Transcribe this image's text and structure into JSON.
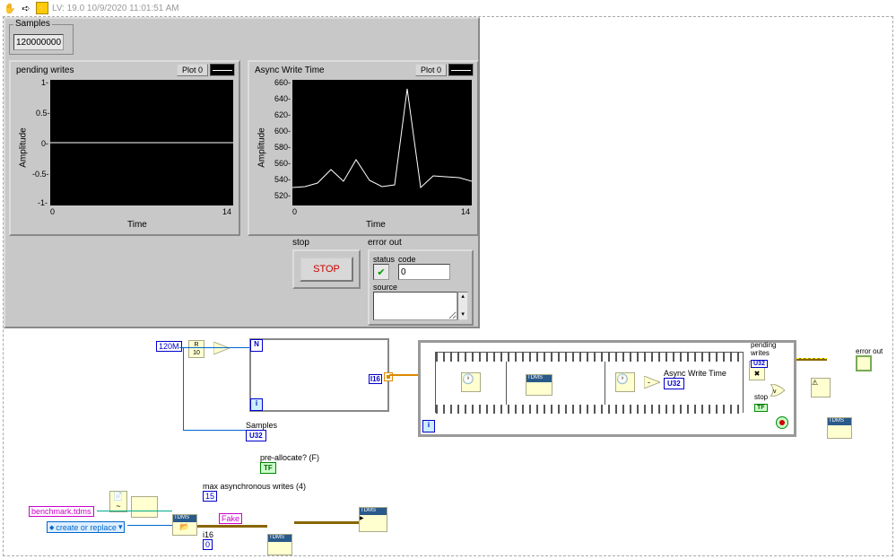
{
  "title": "LV: 19.0 10/9/2020 11:01:51 AM",
  "samples": {
    "label": "Samples",
    "value": "120000000"
  },
  "chart1": {
    "title": "pending writes",
    "legend": "Plot 0",
    "ylabel": "Amplitude",
    "xlabel": "Time",
    "xmin": "0",
    "xmax": "14"
  },
  "chart2": {
    "title": "Async Write Time",
    "legend": "Plot 0",
    "ylabel": "Amplitude",
    "xlabel": "Time",
    "xmin": "0",
    "xmax": "14"
  },
  "chart_data": [
    {
      "type": "line",
      "title": "pending writes",
      "xlabel": "Time",
      "ylabel": "Amplitude",
      "xlim": [
        0,
        14
      ],
      "ylim": [
        -1,
        1
      ],
      "x": [
        0,
        1,
        2,
        3,
        4,
        5,
        6,
        7,
        8,
        9,
        10,
        11,
        12,
        13,
        14
      ],
      "values": [
        0,
        0,
        0,
        0,
        0,
        0,
        0,
        0,
        0,
        0,
        0,
        0,
        0,
        0,
        0
      ]
    },
    {
      "type": "line",
      "title": "Async Write Time",
      "xlabel": "Time",
      "ylabel": "Amplitude",
      "xlim": [
        0,
        14
      ],
      "ylim": [
        520,
        660
      ],
      "x": [
        0,
        1,
        2,
        3,
        4,
        5,
        6,
        7,
        8,
        9,
        10,
        11,
        12,
        13,
        14
      ],
      "values": [
        540,
        541,
        545,
        560,
        547,
        571,
        548,
        541,
        543,
        650,
        540,
        553,
        552,
        551,
        547
      ]
    }
  ],
  "stop": {
    "label": "stop",
    "button": "STOP"
  },
  "error": {
    "label": "error out",
    "status_label": "status",
    "code_label": "code",
    "code_value": "0",
    "source_label": "source"
  },
  "bd": {
    "c120m": "120M",
    "samples_label": "Samples",
    "samples_type": "U32",
    "prealloc_label": "pre-allocate? (F)",
    "prealloc_type": "TF",
    "maxasync_label": "max asynchronous writes (4)",
    "maxasync_val": "15",
    "bench": "benchmark.tdms",
    "createreplace": "create or replace",
    "fake": "Fake",
    "i16_label": "i16",
    "i16_val": "0",
    "n_term": "N",
    "i_term": "i",
    "i16_type": "I16",
    "awt_label": "Async Write Time",
    "awt_type": "U32",
    "pending_label": "pending writes",
    "pending_type": "U32",
    "bd_stop_label": "stop",
    "bd_stop_type": "TF",
    "errorout_label": "error out",
    "tdms": "TDMS"
  }
}
